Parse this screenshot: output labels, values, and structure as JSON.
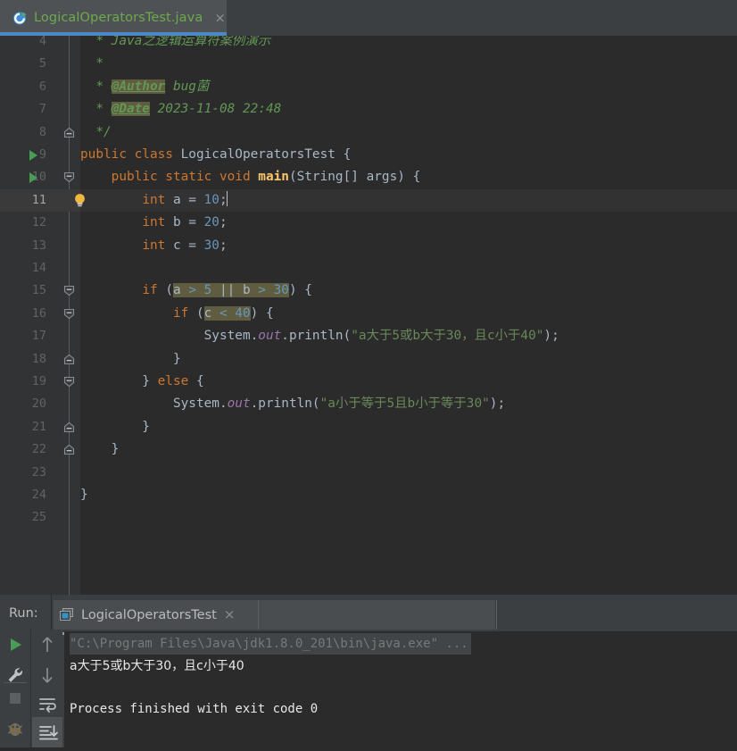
{
  "window": {
    "colors": {
      "editor_bg": "#2b2b2b",
      "gutter_bg": "#313335",
      "panel_bg": "#3c3f41",
      "accent_blue": "#4a88c7",
      "keyword_orange": "#cc7832",
      "string_green": "#6a8759",
      "comment_green": "#629755",
      "number_blue": "#6897bb",
      "method_yellow": "#ffc66d",
      "field_purple": "#9876aa",
      "run_green": "#499c54",
      "highlight_olive": "#5f5c3f",
      "current_line": "#323232"
    }
  },
  "tabbar": {
    "tabs": [
      {
        "label": "LogicalOperatorsTest.java",
        "icon": "java-class-icon",
        "close_glyph": "×",
        "active": true
      }
    ]
  },
  "editor": {
    "first_visible_line": 4,
    "current_line": 11,
    "caret_line": 11,
    "lines": [
      {
        "number": 4,
        "gutter": {
          "run_marker": false,
          "bulb": false,
          "fold": null
        },
        "tokens": [
          {
            "text": "  * ",
            "kind": "cmt"
          },
          {
            "text": "Java之逻辑运算符案例演示",
            "kind": "cmt"
          }
        ]
      },
      {
        "number": 5,
        "gutter": {
          "run_marker": false,
          "bulb": false,
          "fold": null
        },
        "tokens": [
          {
            "text": "  *",
            "kind": "cmt"
          }
        ]
      },
      {
        "number": 6,
        "gutter": {
          "run_marker": false,
          "bulb": false,
          "fold": null
        },
        "tokens": [
          {
            "text": "  * ",
            "kind": "cmt"
          },
          {
            "text": "@Author",
            "kind": "cmt-tag"
          },
          {
            "text": " bug菌",
            "kind": "cmt"
          }
        ]
      },
      {
        "number": 7,
        "gutter": {
          "run_marker": false,
          "bulb": false,
          "fold": null
        },
        "tokens": [
          {
            "text": "  * ",
            "kind": "cmt"
          },
          {
            "text": "@Date",
            "kind": "cmt-tag"
          },
          {
            "text": " 2023-11-08 22:48",
            "kind": "cmt"
          }
        ]
      },
      {
        "number": 8,
        "gutter": {
          "run_marker": false,
          "bulb": false,
          "fold": "end"
        },
        "tokens": [
          {
            "text": "  */",
            "kind": "cmt"
          }
        ]
      },
      {
        "number": 9,
        "gutter": {
          "run_marker": true,
          "bulb": false,
          "fold": null
        },
        "tokens": [
          {
            "text": "public class ",
            "kind": "kw"
          },
          {
            "text": "LogicalOperatorsTest ",
            "kind": "plain"
          },
          {
            "text": "{",
            "kind": "plain"
          }
        ]
      },
      {
        "number": 10,
        "gutter": {
          "run_marker": true,
          "bulb": false,
          "fold": "start"
        },
        "tokens": [
          {
            "text": "    ",
            "kind": "plain"
          },
          {
            "text": "public static void ",
            "kind": "kw"
          },
          {
            "text": "main",
            "kind": "mtd"
          },
          {
            "text": "(",
            "kind": "plain"
          },
          {
            "text": "String",
            "kind": "cls"
          },
          {
            "text": "[] args) {",
            "kind": "plain"
          }
        ]
      },
      {
        "number": 11,
        "gutter": {
          "run_marker": false,
          "bulb": true,
          "fold": null
        },
        "tokens": [
          {
            "text": "        ",
            "kind": "plain"
          },
          {
            "text": "int ",
            "kind": "kw"
          },
          {
            "text": "a = ",
            "kind": "plain"
          },
          {
            "text": "10",
            "kind": "num"
          },
          {
            "text": ";",
            "kind": "plain"
          }
        ],
        "caret_after": true
      },
      {
        "number": 12,
        "gutter": {
          "run_marker": false,
          "bulb": false,
          "fold": null
        },
        "tokens": [
          {
            "text": "        ",
            "kind": "plain"
          },
          {
            "text": "int ",
            "kind": "kw"
          },
          {
            "text": "b = ",
            "kind": "plain"
          },
          {
            "text": "20",
            "kind": "num"
          },
          {
            "text": ";",
            "kind": "plain"
          }
        ]
      },
      {
        "number": 13,
        "gutter": {
          "run_marker": false,
          "bulb": false,
          "fold": null
        },
        "tokens": [
          {
            "text": "        ",
            "kind": "plain"
          },
          {
            "text": "int ",
            "kind": "kw"
          },
          {
            "text": "c = ",
            "kind": "plain"
          },
          {
            "text": "30",
            "kind": "num"
          },
          {
            "text": ";",
            "kind": "plain"
          }
        ]
      },
      {
        "number": 14,
        "gutter": {
          "run_marker": false,
          "bulb": false,
          "fold": null
        },
        "tokens": []
      },
      {
        "number": 15,
        "gutter": {
          "run_marker": false,
          "bulb": false,
          "fold": "start"
        },
        "tokens": [
          {
            "text": "        ",
            "kind": "plain"
          },
          {
            "text": "if ",
            "kind": "kw"
          },
          {
            "text": "(",
            "kind": "plain"
          },
          {
            "text": "a ",
            "kind": "plain-hl"
          },
          {
            "text": "> ",
            "kind": "num-hl"
          },
          {
            "text": "5 ",
            "kind": "num-hl"
          },
          {
            "text": "|| ",
            "kind": "plain-hl"
          },
          {
            "text": "b ",
            "kind": "plain-hl"
          },
          {
            "text": "> ",
            "kind": "num-hl"
          },
          {
            "text": "30",
            "kind": "num-hl"
          },
          {
            "text": ") {",
            "kind": "plain"
          }
        ]
      },
      {
        "number": 16,
        "gutter": {
          "run_marker": false,
          "bulb": false,
          "fold": "start"
        },
        "tokens": [
          {
            "text": "            ",
            "kind": "plain"
          },
          {
            "text": "if ",
            "kind": "kw"
          },
          {
            "text": "(",
            "kind": "plain"
          },
          {
            "text": "c ",
            "kind": "plain-hl"
          },
          {
            "text": "< ",
            "kind": "num-hl"
          },
          {
            "text": "40",
            "kind": "num-hl"
          },
          {
            "text": ") {",
            "kind": "plain"
          }
        ]
      },
      {
        "number": 17,
        "gutter": {
          "run_marker": false,
          "bulb": false,
          "fold": null
        },
        "tokens": [
          {
            "text": "                ",
            "kind": "plain"
          },
          {
            "text": "System",
            "kind": "cls"
          },
          {
            "text": ".",
            "kind": "plain"
          },
          {
            "text": "out",
            "kind": "fld"
          },
          {
            "text": ".println(",
            "kind": "plain"
          },
          {
            "text": "\"a大于5或b大于30，且c小于40\"",
            "kind": "str"
          },
          {
            "text": ");",
            "kind": "plain"
          }
        ]
      },
      {
        "number": 18,
        "gutter": {
          "run_marker": false,
          "bulb": false,
          "fold": "end"
        },
        "tokens": [
          {
            "text": "            }",
            "kind": "plain"
          }
        ]
      },
      {
        "number": 19,
        "gutter": {
          "run_marker": false,
          "bulb": false,
          "fold": "start"
        },
        "tokens": [
          {
            "text": "        } ",
            "kind": "plain"
          },
          {
            "text": "else ",
            "kind": "kw"
          },
          {
            "text": "{",
            "kind": "plain"
          }
        ]
      },
      {
        "number": 20,
        "gutter": {
          "run_marker": false,
          "bulb": false,
          "fold": null
        },
        "tokens": [
          {
            "text": "            ",
            "kind": "plain"
          },
          {
            "text": "System",
            "kind": "cls"
          },
          {
            "text": ".",
            "kind": "plain"
          },
          {
            "text": "out",
            "kind": "fld"
          },
          {
            "text": ".println(",
            "kind": "plain"
          },
          {
            "text": "\"a小于等于5且b小于等于30\"",
            "kind": "str"
          },
          {
            "text": ");",
            "kind": "plain"
          }
        ]
      },
      {
        "number": 21,
        "gutter": {
          "run_marker": false,
          "bulb": false,
          "fold": "end"
        },
        "tokens": [
          {
            "text": "        }",
            "kind": "plain"
          }
        ]
      },
      {
        "number": 22,
        "gutter": {
          "run_marker": false,
          "bulb": false,
          "fold": "end"
        },
        "tokens": [
          {
            "text": "    }",
            "kind": "plain"
          }
        ]
      },
      {
        "number": 23,
        "gutter": {
          "run_marker": false,
          "bulb": false,
          "fold": null
        },
        "tokens": []
      },
      {
        "number": 24,
        "gutter": {
          "run_marker": false,
          "bulb": false,
          "fold": null
        },
        "tokens": [
          {
            "text": "}",
            "kind": "plain"
          }
        ]
      },
      {
        "number": 25,
        "gutter": {
          "run_marker": false,
          "bulb": false,
          "fold": null
        },
        "tokens": []
      }
    ]
  },
  "run_panel": {
    "label": "Run:",
    "tab": {
      "label": "LogicalOperatorsTest",
      "icon": "console-icon",
      "close_glyph": "×"
    },
    "toolbar_left": [
      {
        "name": "rerun-button",
        "icon": "play-icon"
      },
      {
        "name": "edit-configurations-button",
        "icon": "wrench-icon"
      },
      {
        "name": "stop-button",
        "icon": "stop-icon"
      },
      {
        "name": "debug-button",
        "icon": "bug-icon"
      }
    ],
    "toolbar_right": [
      {
        "name": "up-stack-trace-button",
        "icon": "arrow-up-icon"
      },
      {
        "name": "down-stack-trace-button",
        "icon": "arrow-down-icon"
      },
      {
        "name": "soft-wrap-button",
        "icon": "soft-wrap-icon"
      },
      {
        "name": "scroll-to-end-button",
        "icon": "scroll-to-end-icon",
        "selected": true
      }
    ],
    "console": {
      "command_line": "\"C:\\Program Files\\Java\\jdk1.8.0_201\\bin\\java.exe\" ...",
      "lines": [
        "a大于5或b大于30，且c小于40",
        "",
        "Process finished with exit code 0"
      ]
    }
  }
}
